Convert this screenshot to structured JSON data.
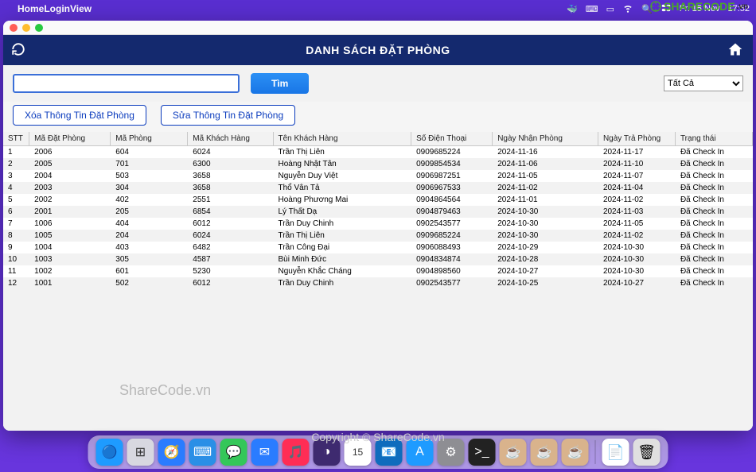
{
  "menubar": {
    "app_name": "HomeLoginView",
    "date": "Fri 15 Nov",
    "time": "17:52"
  },
  "logo": {
    "text": "SHARECODE",
    "suffix": ".vn"
  },
  "header": {
    "title": "DANH SÁCH ĐẶT PHÒNG"
  },
  "toolbar": {
    "search_value": "",
    "search_placeholder": "",
    "btn_search": "Tìm",
    "filter_selected": "Tất Cả",
    "filter_options": [
      "Tất Cả"
    ],
    "btn_delete": "Xóa Thông Tin Đặt Phòng",
    "btn_edit": "Sửa Thông Tin Đặt Phòng"
  },
  "table": {
    "headers": [
      "STT",
      "Mã Đặt Phòng",
      "Mã Phòng",
      "Mã Khách Hàng",
      "Tên Khách Hàng",
      "Số Điện Thoại",
      "Ngày Nhận Phòng",
      "Ngày Trả Phòng",
      "Trạng thái"
    ],
    "rows": [
      [
        "1",
        "2006",
        "604",
        "6024",
        "Trần Thị Liên",
        "0909685224",
        "2024-11-16",
        "2024-11-17",
        "Đã Check In"
      ],
      [
        "2",
        "2005",
        "701",
        "6300",
        "Hoàng Nhật Tân",
        "0909854534",
        "2024-11-06",
        "2024-11-10",
        "Đã Check In"
      ],
      [
        "3",
        "2004",
        "503",
        "3658",
        "Nguyễn Duy Việt",
        "0906987251",
        "2024-11-05",
        "2024-11-07",
        "Đã Check In"
      ],
      [
        "4",
        "2003",
        "304",
        "3658",
        "Thổ Vân Tả",
        "0906967533",
        "2024-11-02",
        "2024-11-04",
        "Đã Check In"
      ],
      [
        "5",
        "2002",
        "402",
        "2551",
        "Hoàng Phương Mai",
        "0904864564",
        "2024-11-01",
        "2024-11-02",
        "Đã Check In"
      ],
      [
        "6",
        "2001",
        "205",
        "6854",
        "Lý Thất Dạ",
        "0904879463",
        "2024-10-30",
        "2024-11-03",
        "Đã Check In"
      ],
      [
        "7",
        "1006",
        "404",
        "6012",
        "Trần Duy Chinh",
        "0902543577",
        "2024-10-30",
        "2024-11-05",
        "Đã Check In"
      ],
      [
        "8",
        "1005",
        "204",
        "6024",
        "Trần Thị Liên",
        "0909685224",
        "2024-10-30",
        "2024-11-02",
        "Đã Check In"
      ],
      [
        "9",
        "1004",
        "403",
        "6482",
        "Trần Công Đại",
        "0906088493",
        "2024-10-29",
        "2024-10-30",
        "Đã Check In"
      ],
      [
        "10",
        "1003",
        "305",
        "4587",
        "Bùi Minh Đức",
        "0904834874",
        "2024-10-28",
        "2024-10-30",
        "Đã Check In"
      ],
      [
        "11",
        "1002",
        "601",
        "5230",
        "Nguyễn Khắc Cháng",
        "0904898560",
        "2024-10-27",
        "2024-10-30",
        "Đã Check In"
      ],
      [
        "12",
        "1001",
        "502",
        "6012",
        "Trần Duy Chinh",
        "0902543577",
        "2024-10-25",
        "2024-10-27",
        "Đã Check In"
      ]
    ]
  },
  "watermarks": {
    "w1": "ShareCode.vn",
    "w2": "Copyright © ShareCode.vn"
  },
  "dock": {
    "items": [
      {
        "name": "finder",
        "bg": "#1e9bff",
        "glyph": "🔵"
      },
      {
        "name": "launchpad",
        "bg": "#d8d8e0",
        "glyph": "⊞"
      },
      {
        "name": "safari",
        "bg": "#2a7cff",
        "glyph": "🧭"
      },
      {
        "name": "vscode",
        "bg": "#2a8fe6",
        "glyph": "⌨"
      },
      {
        "name": "messages",
        "bg": "#34c759",
        "glyph": "💬"
      },
      {
        "name": "mail",
        "bg": "#2a7cff",
        "glyph": "✉"
      },
      {
        "name": "music",
        "bg": "#ff2d55",
        "glyph": "🎵"
      },
      {
        "name": "eclipse",
        "bg": "#3e2a6f",
        "glyph": "◑"
      },
      {
        "name": "calendar",
        "bg": "#ffffff",
        "glyph": "15"
      },
      {
        "name": "outlook",
        "bg": "#0f6cbd",
        "glyph": "📧"
      },
      {
        "name": "appstore",
        "bg": "#1e9bff",
        "glyph": "A"
      },
      {
        "name": "settings",
        "bg": "#8e8e93",
        "glyph": "⚙"
      },
      {
        "name": "terminal",
        "bg": "#222",
        "glyph": ">_"
      },
      {
        "name": "java1",
        "bg": "#d9b38c",
        "glyph": "☕"
      },
      {
        "name": "java2",
        "bg": "#d9b38c",
        "glyph": "☕"
      },
      {
        "name": "java3",
        "bg": "#d9b38c",
        "glyph": "☕"
      }
    ],
    "trailing": [
      {
        "name": "downloads",
        "bg": "#ffffff",
        "glyph": "📄"
      },
      {
        "name": "trash",
        "bg": "#e0e0e0",
        "glyph": "🗑"
      }
    ]
  }
}
